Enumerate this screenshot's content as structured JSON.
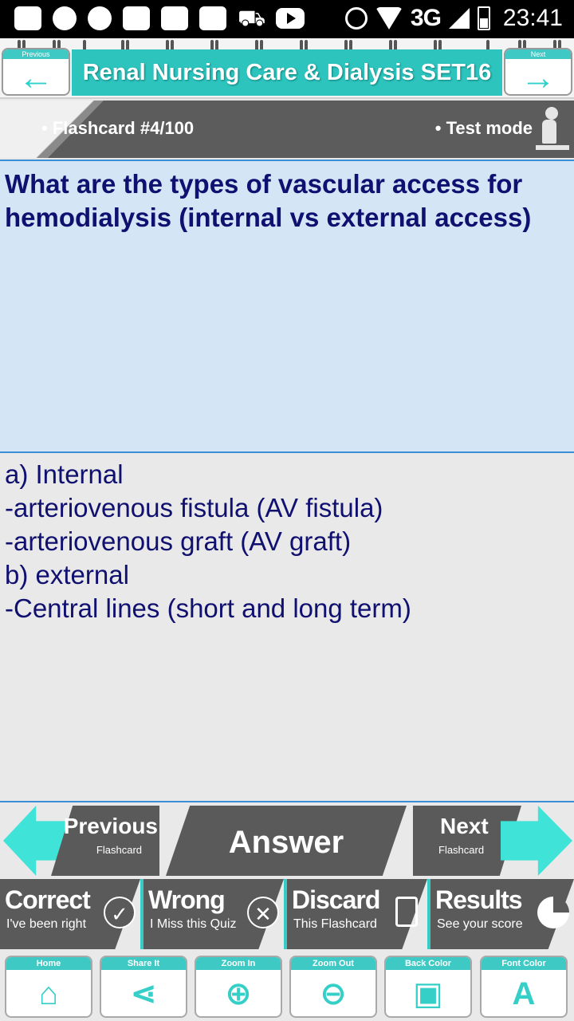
{
  "status_bar": {
    "network": "3G",
    "time": "23:41",
    "icons": [
      "message-icon",
      "missed-call-icon",
      "night-mode-icon",
      "chat-icon",
      "camera-icon",
      "n-app-icon",
      "cart-icon",
      "youtube-icon",
      "alarm-icon",
      "wifi-icon",
      "signal-icon",
      "battery-icon"
    ]
  },
  "header": {
    "prev_caption": "Previous",
    "next_caption": "Next",
    "prev_arrow": "←",
    "next_arrow": "→",
    "title": "Renal Nursing Care & Dialysis SET16"
  },
  "info": {
    "flashcard": "• Flashcard #4/100",
    "mode": "• Test mode"
  },
  "question": {
    "text": "What are the types of vascular access for hemodialysis (internal vs external access)"
  },
  "answer": {
    "lines": [
      "a) Internal",
      "-arteriovenous fistula (AV fistula)",
      "-arteriovenous graft (AV graft)",
      "b) external",
      "-Central lines (short and long term)"
    ]
  },
  "nav": {
    "prev_big": "Previous",
    "prev_small": "Flashcard",
    "answer": "Answer",
    "next_big": "Next",
    "next_small": "Flashcard"
  },
  "actions": [
    {
      "title": "Correct",
      "sub": "I've been right",
      "icon": "✓"
    },
    {
      "title": "Wrong",
      "sub": "I Miss this Quiz",
      "icon": "✕"
    },
    {
      "title": "Discard",
      "sub": "This Flashcard",
      "icon": ""
    },
    {
      "title": "Results",
      "sub": "See your score",
      "icon": ""
    }
  ],
  "toolbar": [
    {
      "caption": "Home",
      "glyph": "⌂"
    },
    {
      "caption": "Share It",
      "glyph": "⋖"
    },
    {
      "caption": "Zoom In",
      "glyph": "⊕"
    },
    {
      "caption": "Zoom Out",
      "glyph": "⊖"
    },
    {
      "caption": "Back Color",
      "glyph": "▣"
    },
    {
      "caption": "Font Color",
      "glyph": "A"
    }
  ],
  "colors": {
    "accent": "#2ec4be",
    "question_bg": "#d4e6f6",
    "text": "#101070",
    "panel": "#5a5a5a"
  }
}
